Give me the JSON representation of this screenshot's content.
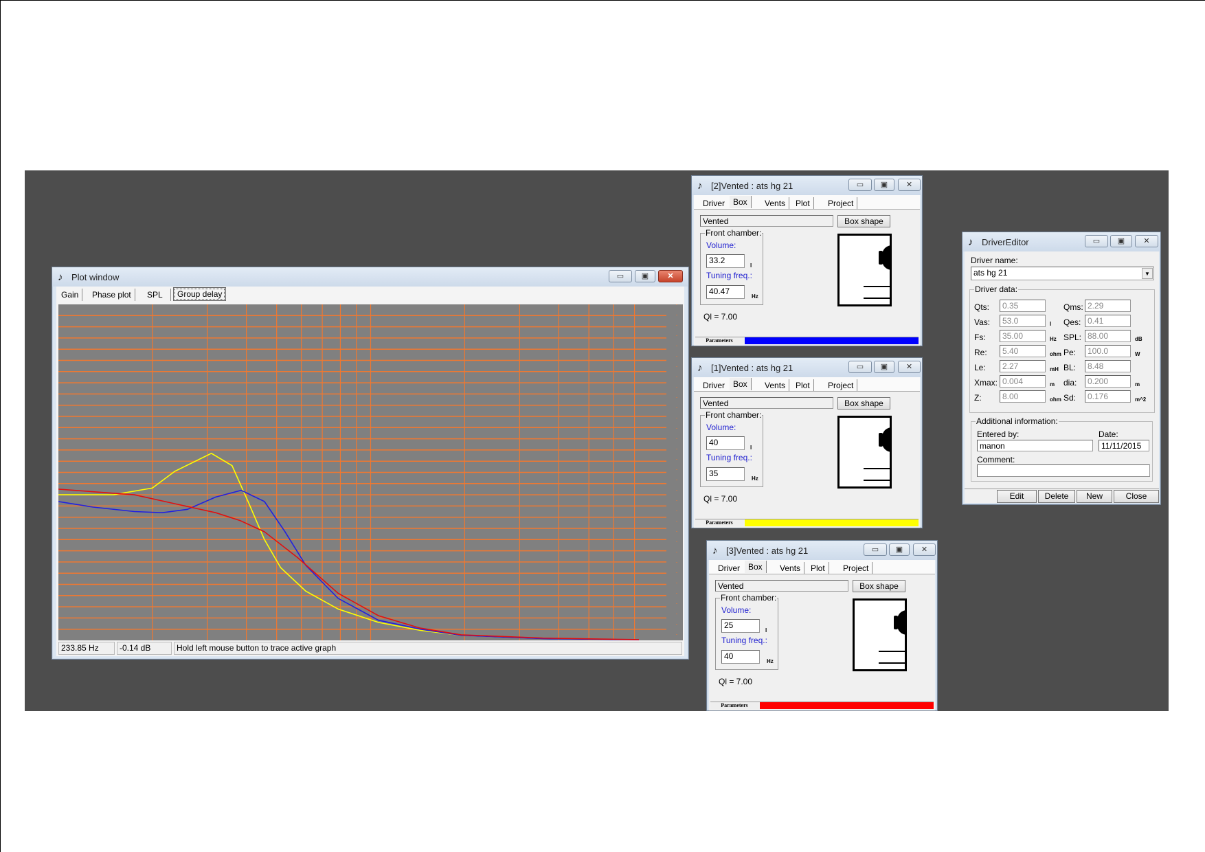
{
  "plot_window": {
    "title": "Plot window",
    "tabs": [
      {
        "label": "Gain"
      },
      {
        "label": "Phase plot"
      },
      {
        "label": "SPL"
      },
      {
        "label": "Group delay",
        "active": true
      }
    ],
    "status": {
      "frequency": "233.85 Hz",
      "level": "-0.14 dB",
      "hint": "Hold left mouse button to trace active graph"
    },
    "colors": {
      "background": "#808080",
      "grid": "#f07830"
    }
  },
  "chart_data": {
    "type": "line",
    "title": "",
    "xlabel": "",
    "ylabel": "",
    "xscale": "log",
    "xlim": [
      10,
      1000
    ],
    "ylim": [
      0,
      30
    ],
    "grid": true,
    "x_gridlines": [
      20,
      30,
      40,
      50,
      60,
      70,
      80,
      90,
      100,
      200,
      300,
      400,
      500,
      600,
      700
    ],
    "y_grid_step": 1,
    "series": [
      {
        "color": "#ffff00",
        "points": [
          [
            10,
            13.0
          ],
          [
            15,
            13.0
          ],
          [
            20,
            13.6
          ],
          [
            23.6,
            15.1
          ],
          [
            30.9,
            16.7
          ],
          [
            36,
            15.6
          ],
          [
            40.5,
            12.4
          ],
          [
            45.7,
            9.0
          ],
          [
            51.5,
            6.5
          ],
          [
            62,
            4.4
          ],
          [
            78.7,
            2.8
          ],
          [
            106,
            1.6
          ],
          [
            144,
            0.9
          ],
          [
            195,
            0.45
          ],
          [
            356,
            0.15
          ],
          [
            723,
            0.05
          ]
        ]
      },
      {
        "color": "#2020e0",
        "points": [
          [
            10,
            12.4
          ],
          [
            12.9,
            11.9
          ],
          [
            17.5,
            11.5
          ],
          [
            21.5,
            11.4
          ],
          [
            25.9,
            11.7
          ],
          [
            31.9,
            12.8
          ],
          [
            38.5,
            13.4
          ],
          [
            45.7,
            12.4
          ],
          [
            53.2,
            9.7
          ],
          [
            62,
            6.7
          ],
          [
            78.7,
            3.75
          ],
          [
            106,
            1.8
          ],
          [
            144,
            1.0
          ],
          [
            195,
            0.45
          ],
          [
            356,
            0.15
          ],
          [
            723,
            0.05
          ]
        ]
      },
      {
        "color": "#e01010",
        "points": [
          [
            10,
            13.5
          ],
          [
            17.5,
            13.0
          ],
          [
            23.6,
            12.2
          ],
          [
            31.9,
            11.4
          ],
          [
            38.2,
            10.7
          ],
          [
            45.7,
            9.7
          ],
          [
            58.3,
            7.4
          ],
          [
            78.7,
            4.2
          ],
          [
            106,
            2.2
          ],
          [
            144,
            1.1
          ],
          [
            195,
            0.5
          ],
          [
            356,
            0.2
          ],
          [
            723,
            0.07
          ]
        ]
      }
    ]
  },
  "vented_windows": [
    {
      "title": "[2]Vented : ats hg 21",
      "tabs": [
        "Driver",
        "Box",
        "Vents",
        "Plot",
        "Project"
      ],
      "box_type": "Vented",
      "box_shape_label": "Box shape",
      "front_chamber_label": "Front chamber:",
      "volume_label": "Volume:",
      "volume": "33.2",
      "volume_unit": "l",
      "tuning_label": "Tuning freq.:",
      "tuning": "40.47",
      "tuning_unit": "Hz",
      "ql": "Ql = 7.00",
      "parameters_label": "Parameters",
      "color": "#0000ff"
    },
    {
      "title": "[1]Vented : ats hg 21",
      "tabs": [
        "Driver",
        "Box",
        "Vents",
        "Plot",
        "Project"
      ],
      "box_type": "Vented",
      "box_shape_label": "Box shape",
      "front_chamber_label": "Front chamber:",
      "volume_label": "Volume:",
      "volume": "40",
      "volume_unit": "l",
      "tuning_label": "Tuning freq.:",
      "tuning": "35",
      "tuning_unit": "Hz",
      "ql": "Ql = 7.00",
      "parameters_label": "Parameters",
      "color": "#ffff00"
    },
    {
      "title": "[3]Vented : ats hg 21",
      "tabs": [
        "Driver",
        "Box",
        "Vents",
        "Plot",
        "Project"
      ],
      "box_type": "Vented",
      "box_shape_label": "Box shape",
      "front_chamber_label": "Front chamber:",
      "volume_label": "Volume:",
      "volume": "25",
      "volume_unit": "l",
      "tuning_label": "Tuning freq.:",
      "tuning": "40",
      "tuning_unit": "Hz",
      "ql": "Ql = 7.00",
      "parameters_label": "Parameters",
      "color": "#ff0000"
    }
  ],
  "driver_editor": {
    "title": "DriverEditor",
    "driver_name_label": "Driver name:",
    "driver_name": "ats hg 21",
    "driver_data_label": "Driver data:",
    "rows": [
      {
        "l1": "Qts:",
        "v1": "0.35",
        "u1": "",
        "l2": "Qms:",
        "v2": "2.29",
        "u2": ""
      },
      {
        "l1": "Vas:",
        "v1": "53.0",
        "u1": "l",
        "l2": "Qes:",
        "v2": "0.41",
        "u2": ""
      },
      {
        "l1": "Fs:",
        "v1": "35.00",
        "u1": "Hz",
        "l2": "SPL:",
        "v2": "88.00",
        "u2": "dB"
      },
      {
        "l1": "Re:",
        "v1": "5.40",
        "u1": "ohm",
        "l2": "Pe:",
        "v2": "100.0",
        "u2": "W"
      },
      {
        "l1": "Le:",
        "v1": "2.27",
        "u1": "mH",
        "l2": "BL:",
        "v2": "8.48",
        "u2": ""
      },
      {
        "l1": "Xmax:",
        "v1": "0.004",
        "u1": "m",
        "l2": "dia:",
        "v2": "0.200",
        "u2": "m"
      },
      {
        "l1": "Z:",
        "v1": "8.00",
        "u1": "ohm",
        "l2": "Sd:",
        "v2": "0.176",
        "u2": "m^2"
      }
    ],
    "additional_label": "Additional information:",
    "entered_by_label": "Entered by:",
    "entered_by": "manon",
    "date_label": "Date:",
    "date": "11/11/2015",
    "comment_label": "Comment:",
    "comment": "",
    "buttons": {
      "edit": "Edit",
      "delete": "Delete",
      "new": "New",
      "close": "Close"
    }
  }
}
